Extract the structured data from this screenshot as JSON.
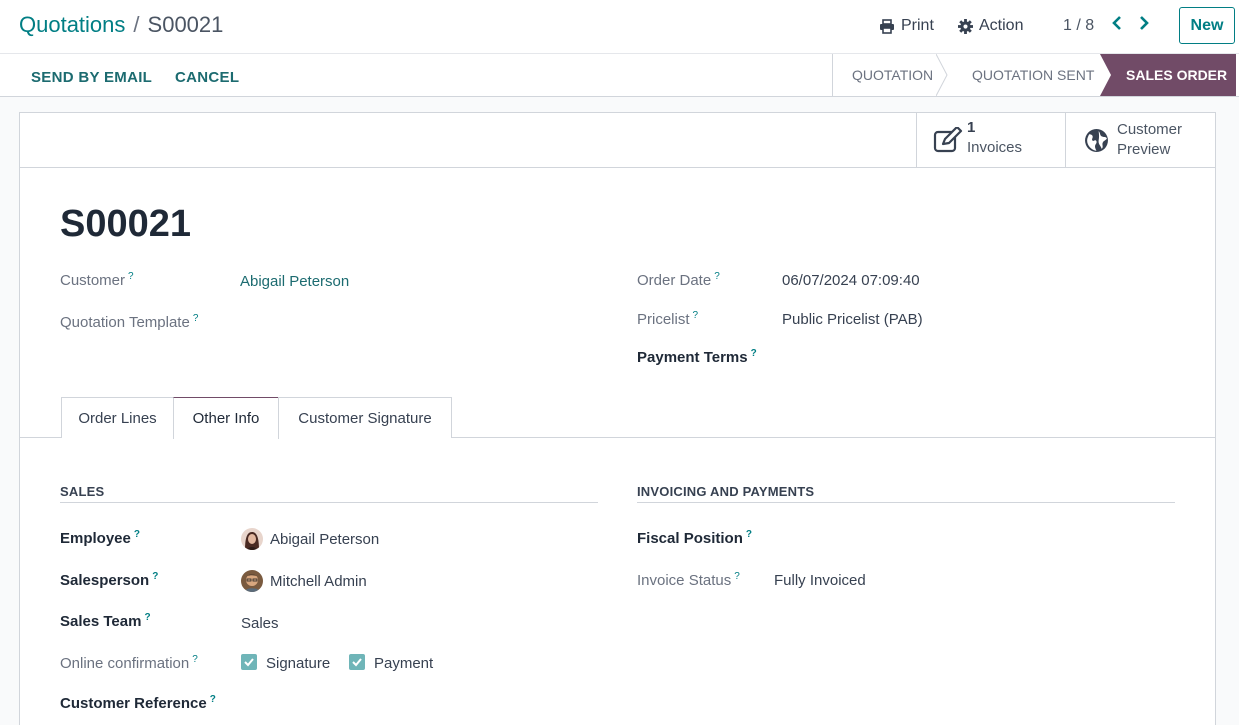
{
  "header": {
    "breadcrumb_parent": "Quotations",
    "breadcrumb_separator": "/",
    "breadcrumb_current": "S00021",
    "print_label": "Print",
    "action_label": "Action",
    "pager": "1 / 8",
    "new_label": "New"
  },
  "actions": {
    "send_email": "SEND BY EMAIL",
    "cancel": "CANCEL"
  },
  "status_stages": [
    {
      "label": "QUOTATION",
      "active": false
    },
    {
      "label": "QUOTATION SENT",
      "active": false
    },
    {
      "label": "SALES ORDER",
      "active": true
    }
  ],
  "smart_buttons": {
    "invoices_count": "1",
    "invoices_label": "Invoices",
    "preview_line1": "Customer",
    "preview_line2": "Preview"
  },
  "record": {
    "title": "S00021",
    "customer_label": "Customer",
    "customer_value": "Abigail Peterson",
    "template_label": "Quotation Template",
    "order_date_label": "Order Date",
    "order_date_value": "06/07/2024 07:09:40",
    "pricelist_label": "Pricelist",
    "pricelist_value": "Public Pricelist (PAB)",
    "payment_terms_label": "Payment Terms",
    "help_mark": "?"
  },
  "tabs": [
    {
      "label": "Order Lines",
      "active": false
    },
    {
      "label": "Other Info",
      "active": true
    },
    {
      "label": "Customer Signature",
      "active": false
    }
  ],
  "sales": {
    "section": "SALES",
    "employee_label": "Employee",
    "employee_value": "Abigail Peterson",
    "salesperson_label": "Salesperson",
    "salesperson_value": "Mitchell Admin",
    "team_label": "Sales Team",
    "team_value": "Sales",
    "online_label": "Online confirmation",
    "signature_label": "Signature",
    "signature_checked": true,
    "payment_label": "Payment",
    "payment_checked": true,
    "reference_label": "Customer Reference"
  },
  "invoicing": {
    "section": "INVOICING AND PAYMENTS",
    "fiscal_label": "Fiscal Position",
    "status_label": "Invoice Status",
    "status_value": "Fully Invoiced"
  },
  "colors": {
    "accent": "#017e84",
    "active_stage": "#714b67"
  }
}
